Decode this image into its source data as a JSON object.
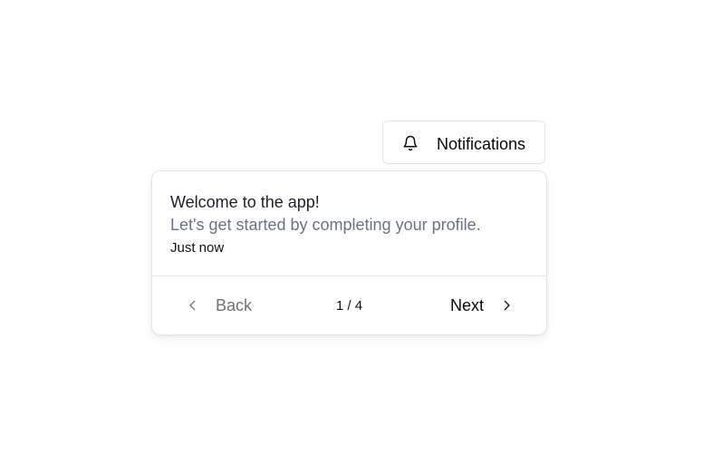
{
  "notifications_button": {
    "label": "Notifications",
    "icon": "bell-icon"
  },
  "notification": {
    "title": "Welcome to the app!",
    "message": "Let's get started by completing your profile.",
    "time": "Just now"
  },
  "pager": {
    "back_label": "Back",
    "back_icon": "chevron-left-icon",
    "counter": "1 / 4",
    "next_label": "Next",
    "next_icon": "chevron-right-icon"
  }
}
